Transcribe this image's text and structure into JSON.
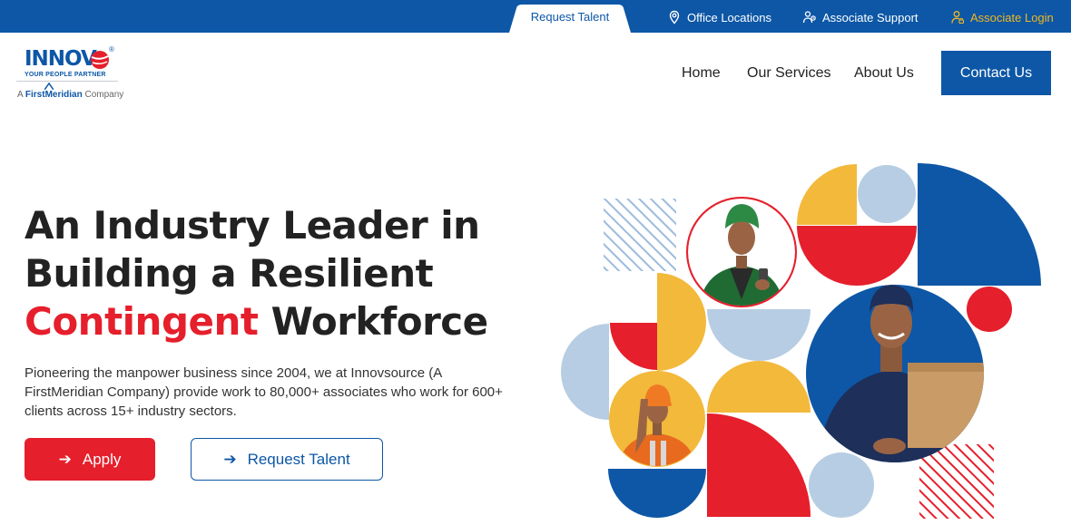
{
  "topbar": {
    "request_tab": "Request Talent",
    "office_locations": "Office Locations",
    "associate_support": "Associate Support",
    "associate_login": "Associate Login"
  },
  "header": {
    "logo_text": "INNOV",
    "logo_tagline": "YOUR PEOPLE PARTNER",
    "logo_company_prefix": "A",
    "logo_company_brand": "FirstMeridian",
    "logo_company_suffix": "Company",
    "nav": {
      "home": "Home",
      "services": "Our Services",
      "about": "About Us",
      "contact": "Contact Us"
    }
  },
  "hero": {
    "title_line1": "An Industry Leader in",
    "title_line2": "Building a Resilient",
    "title_highlight": "Contingent",
    "title_line3_rest": " Workforce",
    "description": "Pioneering the manpower business since 2004, we at Innovsource (A FirstMeridian Company) provide work to 80,000+ associates who work for 600+ clients across 15+ industry sectors.",
    "apply_label": "Apply",
    "request_label": "Request Talent",
    "arrow": "➔"
  },
  "colors": {
    "brand_blue": "#0d57a6",
    "accent_red": "#e51f2b",
    "accent_yellow": "#f2b93b",
    "light_blue": "#b7cde3"
  }
}
